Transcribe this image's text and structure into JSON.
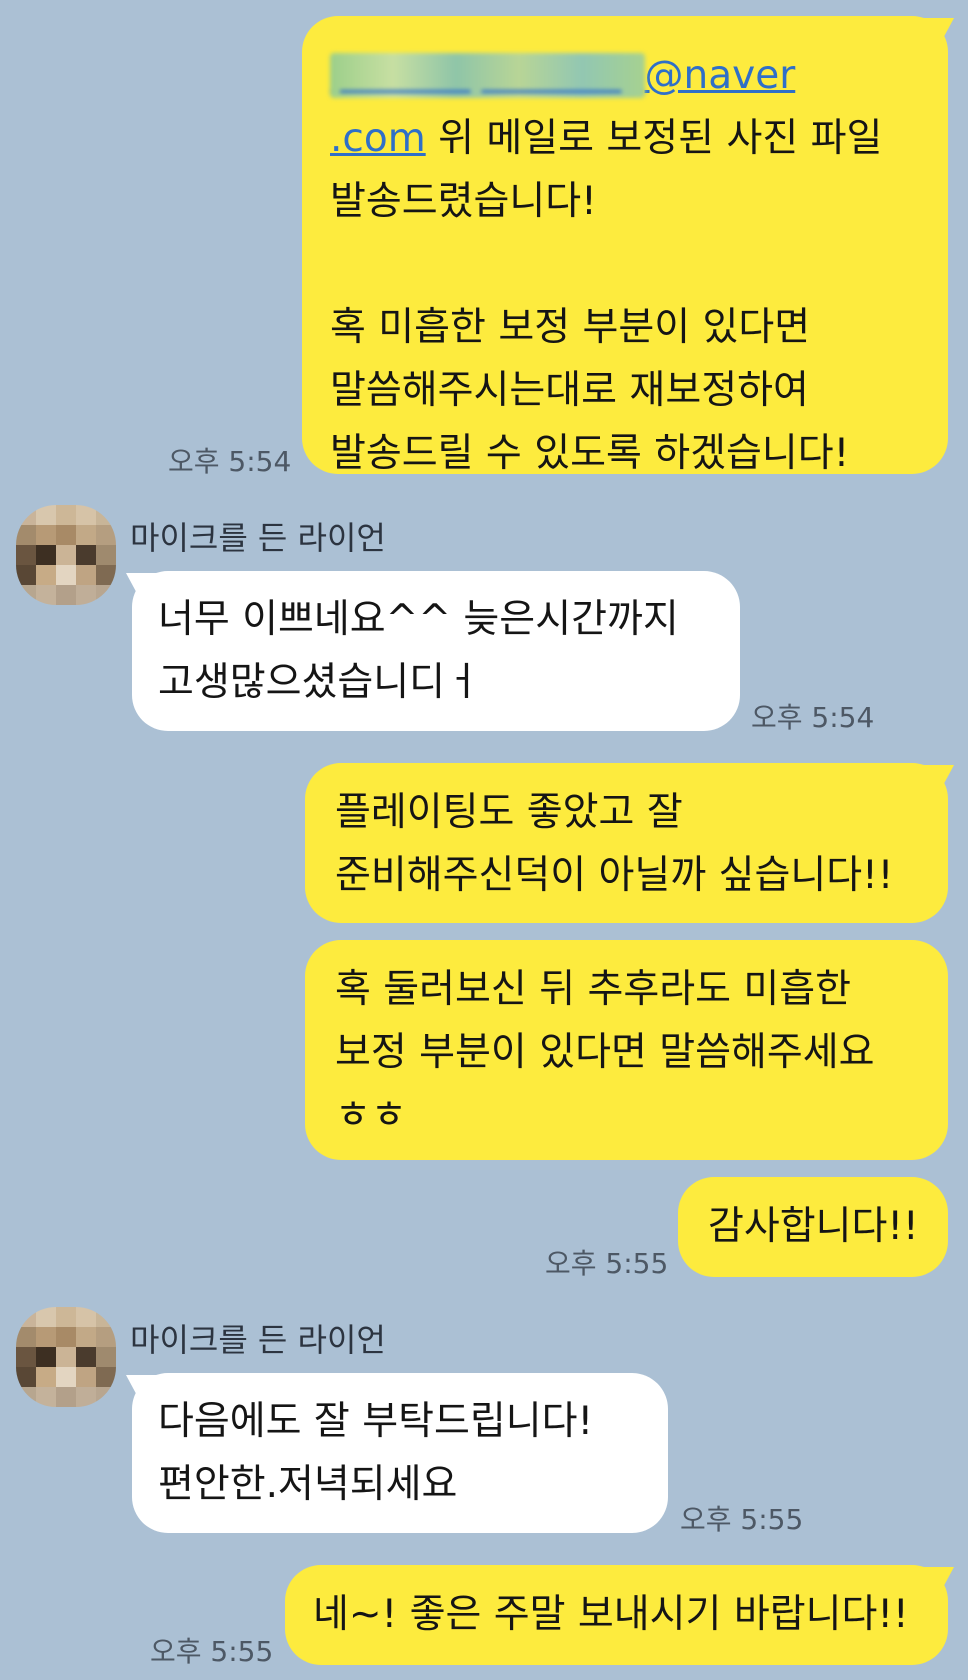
{
  "chat": {
    "participant_name": "마이크를 든 라이언",
    "messages": [
      {
        "side": "me",
        "email_hidden": "pictureyfood_bg",
        "email_domain": "@naver",
        "email_tld": ".com",
        "text_tail": " 위 메일로 보정된 사진 파일\n발송드렸습니다!\n\n혹 미흡한 보정 부분이 있다면\n말씀해주시는대로 재보정하여\n발송드릴 수 있도록 하겠습니다!",
        "time": "오후 5:54"
      },
      {
        "side": "them",
        "text": "너무 이쁘네요^^ 늦은시간까지\n고생많으셨습니디ㅓ",
        "time": "오후 5:54"
      },
      {
        "side": "me",
        "text": "플레이팅도 좋았고 잘\n준비해주신덕이 아닐까 싶습니다!!"
      },
      {
        "side": "me",
        "text": "혹 둘러보신 뒤 추후라도 미흡한\n보정 부분이 있다면 말씀해주세요\nㅎㅎ"
      },
      {
        "side": "me",
        "text": "감사합니다!!",
        "time": "오후 5:55"
      },
      {
        "side": "them",
        "text": "다음에도 잘 부탁드립니다!\n편안한.저녁되세요",
        "time": "오후 5:55"
      },
      {
        "side": "me",
        "text": "네~! 좋은 주말 보내시기 바랍니다!!",
        "time": "오후 5:55"
      }
    ]
  },
  "colors": {
    "background": "#abc0d4",
    "my_bubble": "#fdeb3e",
    "their_bubble": "#ffffff",
    "link": "#2f6fc8"
  },
  "icons": {
    "avatar": "pixelated-avatar-icon"
  }
}
